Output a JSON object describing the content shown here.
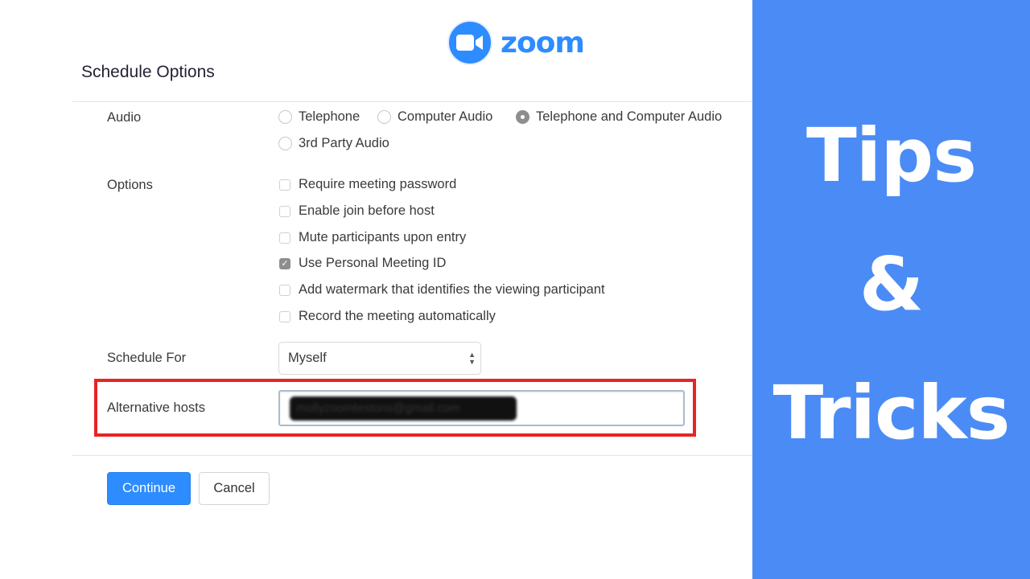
{
  "brand": {
    "logo_icon": "video-camera-icon",
    "name": "zoom",
    "color": "#2d8cff"
  },
  "title": "Schedule Options",
  "audio": {
    "label": "Audio",
    "options": [
      {
        "label": "Telephone",
        "selected": false
      },
      {
        "label": "Computer Audio",
        "selected": false
      },
      {
        "label": "Telephone and Computer Audio",
        "selected": true
      },
      {
        "label": "3rd Party Audio",
        "selected": false
      }
    ]
  },
  "options": {
    "label": "Options",
    "items": [
      {
        "label": "Require meeting password",
        "checked": false
      },
      {
        "label": "Enable join before host",
        "checked": false
      },
      {
        "label": "Mute participants upon entry",
        "checked": false
      },
      {
        "label": "Use Personal Meeting ID",
        "checked": true
      },
      {
        "label": "Add watermark that identifies the viewing participant",
        "checked": false
      },
      {
        "label": "Record the meeting automatically",
        "checked": false
      }
    ]
  },
  "schedule_for": {
    "label": "Schedule For",
    "value": "Myself"
  },
  "alternative_hosts": {
    "label": "Alternative hosts",
    "value": "mollyzoomtestons@gmail.com",
    "redacted": true,
    "highlight_color": "#e82424"
  },
  "buttons": {
    "continue": "Continue",
    "cancel": "Cancel"
  },
  "banner": {
    "line1": "Tips",
    "line2": "&",
    "line3": "Tricks",
    "background": "#4b8bf5"
  }
}
